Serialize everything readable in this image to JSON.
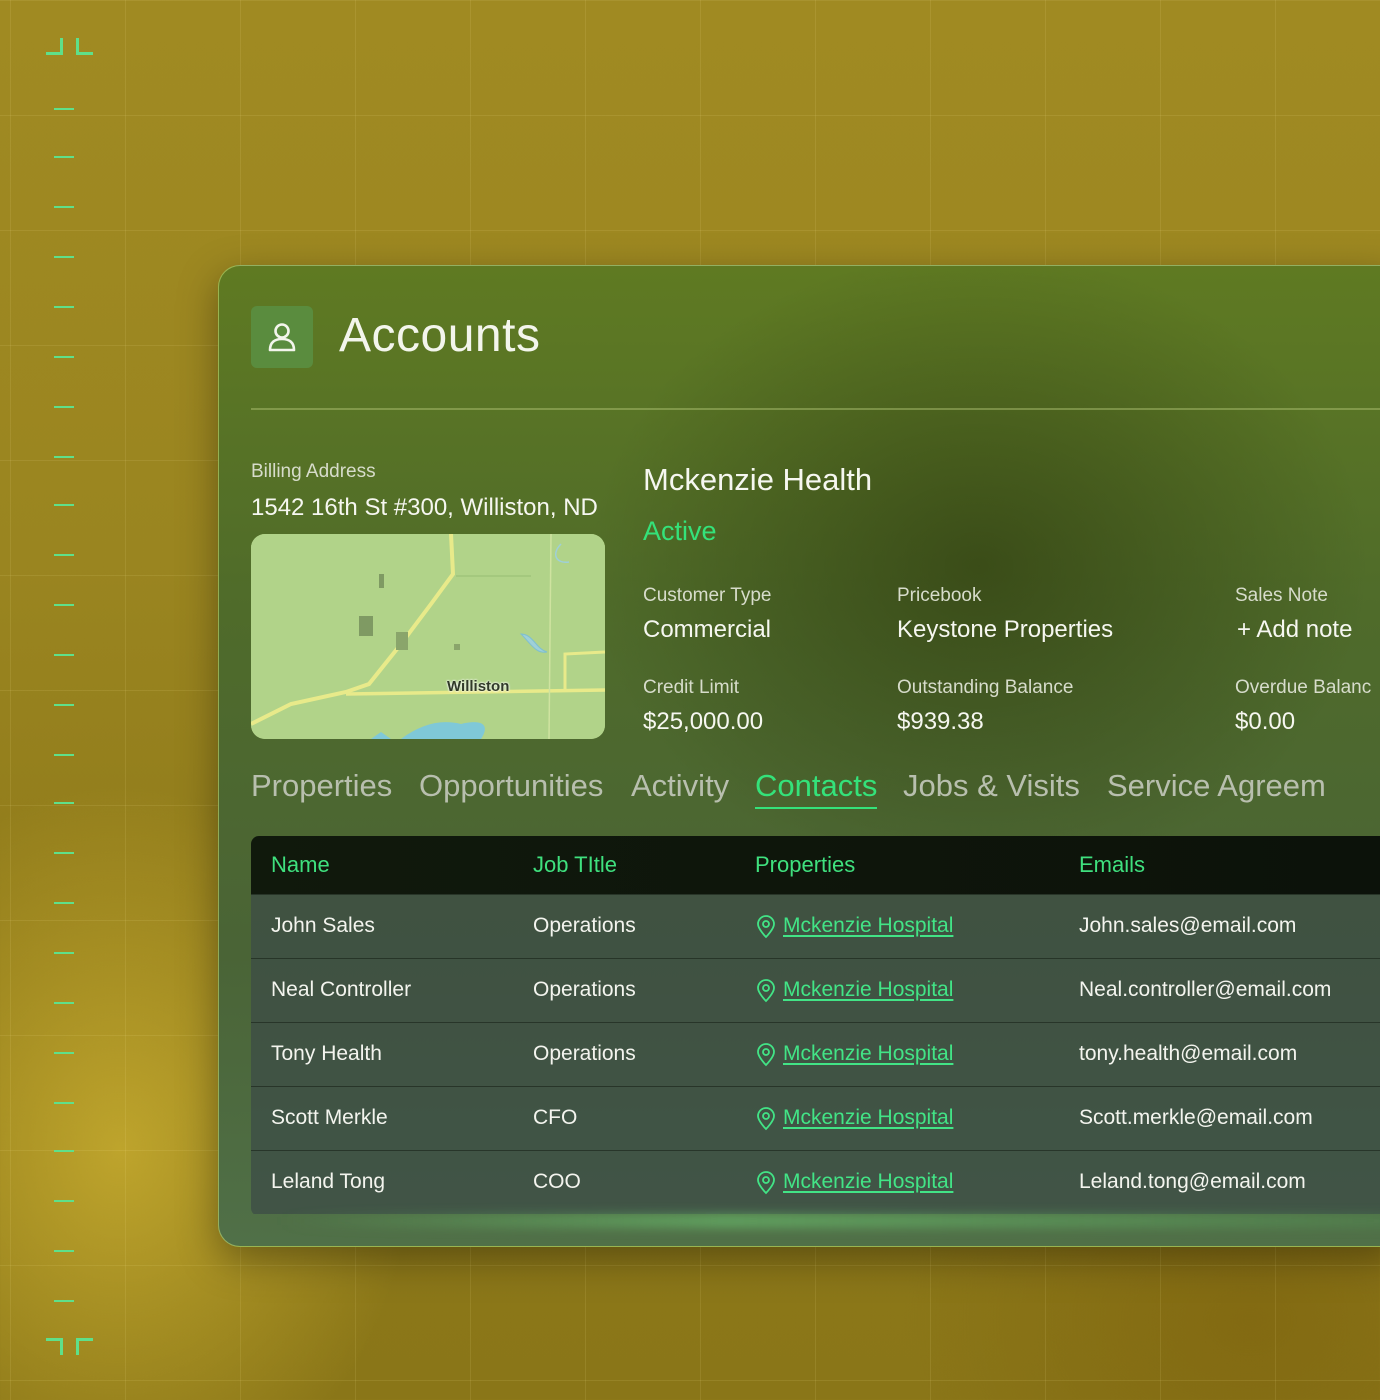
{
  "header": {
    "title": "Accounts"
  },
  "billing": {
    "label": "Billing Address",
    "address": "1542 16th St #300, Williston, ND"
  },
  "map": {
    "place_label": "Williston"
  },
  "account": {
    "name": "Mckenzie Health",
    "status": "Active",
    "customer_type_label": "Customer Type",
    "customer_type": "Commercial",
    "pricebook_label": "Pricebook",
    "pricebook": "Keystone Properties",
    "sales_note_label": "Sales Note",
    "sales_note_action": "+ Add note",
    "credit_limit_label": "Credit Limit",
    "credit_limit": "$25,000.00",
    "outstanding_label": "Outstanding Balance",
    "outstanding": "$939.38",
    "overdue_label": "Overdue Balanc",
    "overdue": "$0.00"
  },
  "tabs": [
    {
      "label": "Properties"
    },
    {
      "label": "Opportunities"
    },
    {
      "label": "Activity"
    },
    {
      "label": "Contacts"
    },
    {
      "label": "Jobs & Visits"
    },
    {
      "label": "Service Agreem"
    }
  ],
  "table": {
    "headers": [
      "Name",
      "Job TItle",
      "Properties",
      "Emails"
    ],
    "rows": [
      {
        "name": "John Sales",
        "title": "Operations",
        "property": "Mckenzie Hospital",
        "email": "John.sales@email.com"
      },
      {
        "name": "Neal Controller",
        "title": "Operations",
        "property": "Mckenzie Hospital",
        "email": "Neal.controller@email.com"
      },
      {
        "name": "Tony Health",
        "title": "Operations",
        "property": "Mckenzie Hospital",
        "email": "tony.health@email.com"
      },
      {
        "name": "Scott Merkle",
        "title": "CFO",
        "property": "Mckenzie Hospital",
        "email": "Scott.merkle@email.com"
      },
      {
        "name": "Leland Tong",
        "title": "COO",
        "property": "Mckenzie Hospital",
        "email": "Leland.tong@email.com"
      }
    ]
  },
  "colors": {
    "accent": "#34e27a",
    "panel": "#4f6b2a",
    "background": "#9a8520"
  }
}
